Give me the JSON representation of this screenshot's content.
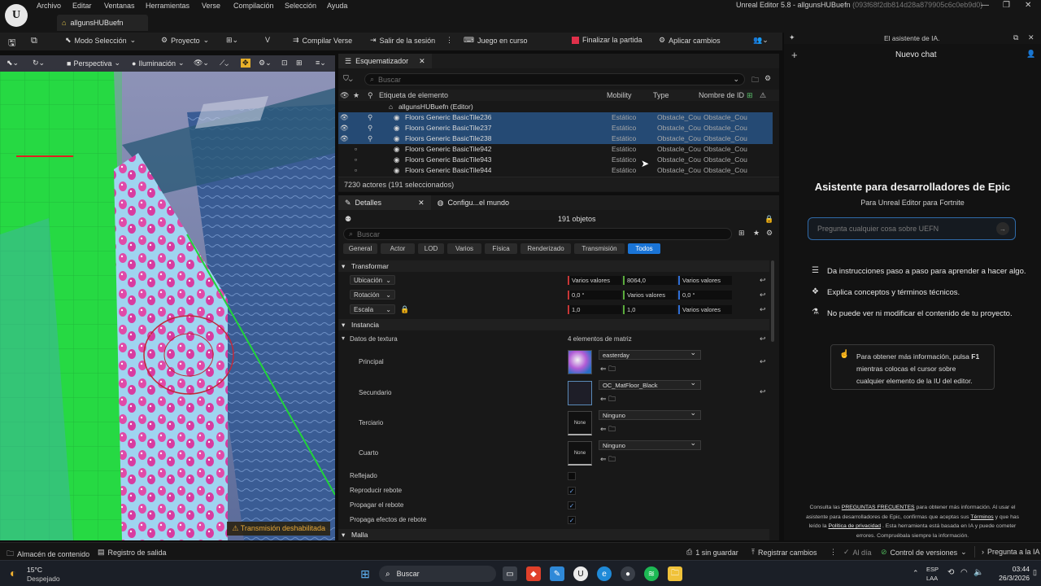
{
  "menubar": {
    "items": [
      "Archivo",
      "Editar",
      "Ventanas",
      "Herramientas",
      "Verse",
      "Compilación",
      "Selección",
      "Ayuda"
    ],
    "document_tab": "allgunsHUBuefn",
    "window_title": "Unreal Editor 5.8 - allgunsHUBuefn",
    "window_hash": "(093f68f2db814d28a879905c6c0eb9d0)"
  },
  "toolbar": {
    "mode": "Modo Selección",
    "project": "Proyecto",
    "compile": "Compilar Verse",
    "leave_session": "Salir de la sesión",
    "game_running": "Juego en curso",
    "end_match": "Finalizar la partida",
    "apply_changes": "Aplicar cambios"
  },
  "viewport": {
    "perspective": "Perspectiva",
    "lighting": "Iluminación",
    "streaming_disabled": "Transmisión deshabilitada"
  },
  "outliner": {
    "tab": "Esquematizador",
    "search_placeholder": "Buscar",
    "columns": {
      "label": "Etiqueta de elemento",
      "mobility": "Mobility",
      "type": "Type",
      "id": "Nombre de ID"
    },
    "root": "allgunsHUBuefn (Editor)",
    "rows": [
      {
        "name": "Floors Generic BasicTile236",
        "mobility": "Estático",
        "type": "Obstacle_Cou",
        "id": "Obstacle_Cou",
        "selected": true
      },
      {
        "name": "Floors Generic BasicTile237",
        "mobility": "Estático",
        "type": "Obstacle_Cou",
        "id": "Obstacle_Cou",
        "selected": true
      },
      {
        "name": "Floors Generic BasicTile238",
        "mobility": "Estático",
        "type": "Obstacle_Cou",
        "id": "Obstacle_Cou",
        "selected": true
      },
      {
        "name": "Floors Generic BasicTile942",
        "mobility": "Estático",
        "type": "Obstacle_Cou",
        "id": "Obstacle_Cou",
        "selected": false
      },
      {
        "name": "Floors Generic BasicTile943",
        "mobility": "Estático",
        "type": "Obstacle_Cou",
        "id": "Obstacle_Cou",
        "selected": false
      },
      {
        "name": "Floors Generic BasicTile944",
        "mobility": "Estático",
        "type": "Obstacle_Cou",
        "id": "Obstacle_Cou",
        "selected": false
      }
    ],
    "footer": "7230 actores (191 seleccionados)"
  },
  "details": {
    "tab": "Detalles",
    "world_tab": "Configu...el mundo",
    "object_count": "191 objetos",
    "search_placeholder": "Buscar",
    "categories": [
      "General",
      "Actor",
      "LOD",
      "Varios",
      "Física",
      "Renderizado",
      "Transmisión",
      "Todos"
    ],
    "active_category": "Todos",
    "transform_section": "Transformar",
    "location": {
      "label": "Ubicación",
      "x": "Varios valores",
      "y": "8064,0",
      "z": "Varios valores"
    },
    "rotation": {
      "label": "Rotación",
      "x": "0,0 °",
      "y": "Varios valores",
      "z": "0,0 °"
    },
    "scale": {
      "label": "Escala",
      "x": "1,0",
      "y": "1,0",
      "z": "Varios valores"
    },
    "instance_section": "Instancia",
    "texture_data": {
      "label": "Datos de textura",
      "value": "4 elementos de matriz"
    },
    "materials": [
      {
        "label": "Principal",
        "value": "easterday",
        "thumb": ""
      },
      {
        "label": "Secundario",
        "value": "OC_MatFloor_Black",
        "thumb": ""
      },
      {
        "label": "Terciario",
        "value": "Ninguno",
        "thumb": "None"
      },
      {
        "label": "Cuarto",
        "value": "Ninguno",
        "thumb": "None"
      }
    ],
    "checkboxes": [
      {
        "label": "Reflejado",
        "checked": false
      },
      {
        "label": "Reproducir rebote",
        "checked": true
      },
      {
        "label": "Propagar el rebote",
        "checked": true
      },
      {
        "label": "Propaga efectos de rebote",
        "checked": true
      }
    ],
    "mesh_section": "Malla"
  },
  "ai": {
    "panel_title": "El asistente de IA.",
    "new_chat": "Nuevo chat",
    "heading": "Asistente para desarrolladores de Epic",
    "subheading": "Para Unreal Editor para Fortnite",
    "input_placeholder": "Pregunta cualquier cosa sobre UEFN",
    "bullets": [
      "Da instrucciones paso a paso para aprender a hacer algo.",
      "Explica conceptos y términos técnicos.",
      "No puede ver ni modificar el contenido de tu proyecto."
    ],
    "hint_prefix": "Para obtener más información, pulsa",
    "hint_key": "F1",
    "hint_line2": "mientras colocas el cursor sobre",
    "hint_line3": "cualquier elemento de la IU del editor.",
    "footer_1": "Consulta las",
    "footer_faq": "PREGUNTAS FRECUENTES",
    "footer_2": "para obtener más información. Al usar el",
    "footer_3": "asistente para desarrolladores de Epic, confirmas que aceptas sus",
    "footer_terms": "Términos",
    "footer_4": "y que has",
    "footer_5": "leído la",
    "footer_privacy": "Política de privacidad",
    "footer_6": ". Esta herramienta está basada en IA y puede cometer",
    "footer_7": "errores. Compruébala siempre la información."
  },
  "statusbar": {
    "content_browser": "Almacén de contenido",
    "output_log": "Registro de salida",
    "unsaved": "1 sin guardar",
    "register_changes": "Registrar cambios",
    "up_to_date": "Al día",
    "version_control": "Control de versiones",
    "ask_ai": "Pregunta a la IA"
  },
  "taskbar": {
    "temp": "15°C",
    "weather": "Despejado",
    "search": "Buscar",
    "lang": "ESP",
    "region": "LAA",
    "time": "03:44",
    "date": "26/3/2026"
  }
}
